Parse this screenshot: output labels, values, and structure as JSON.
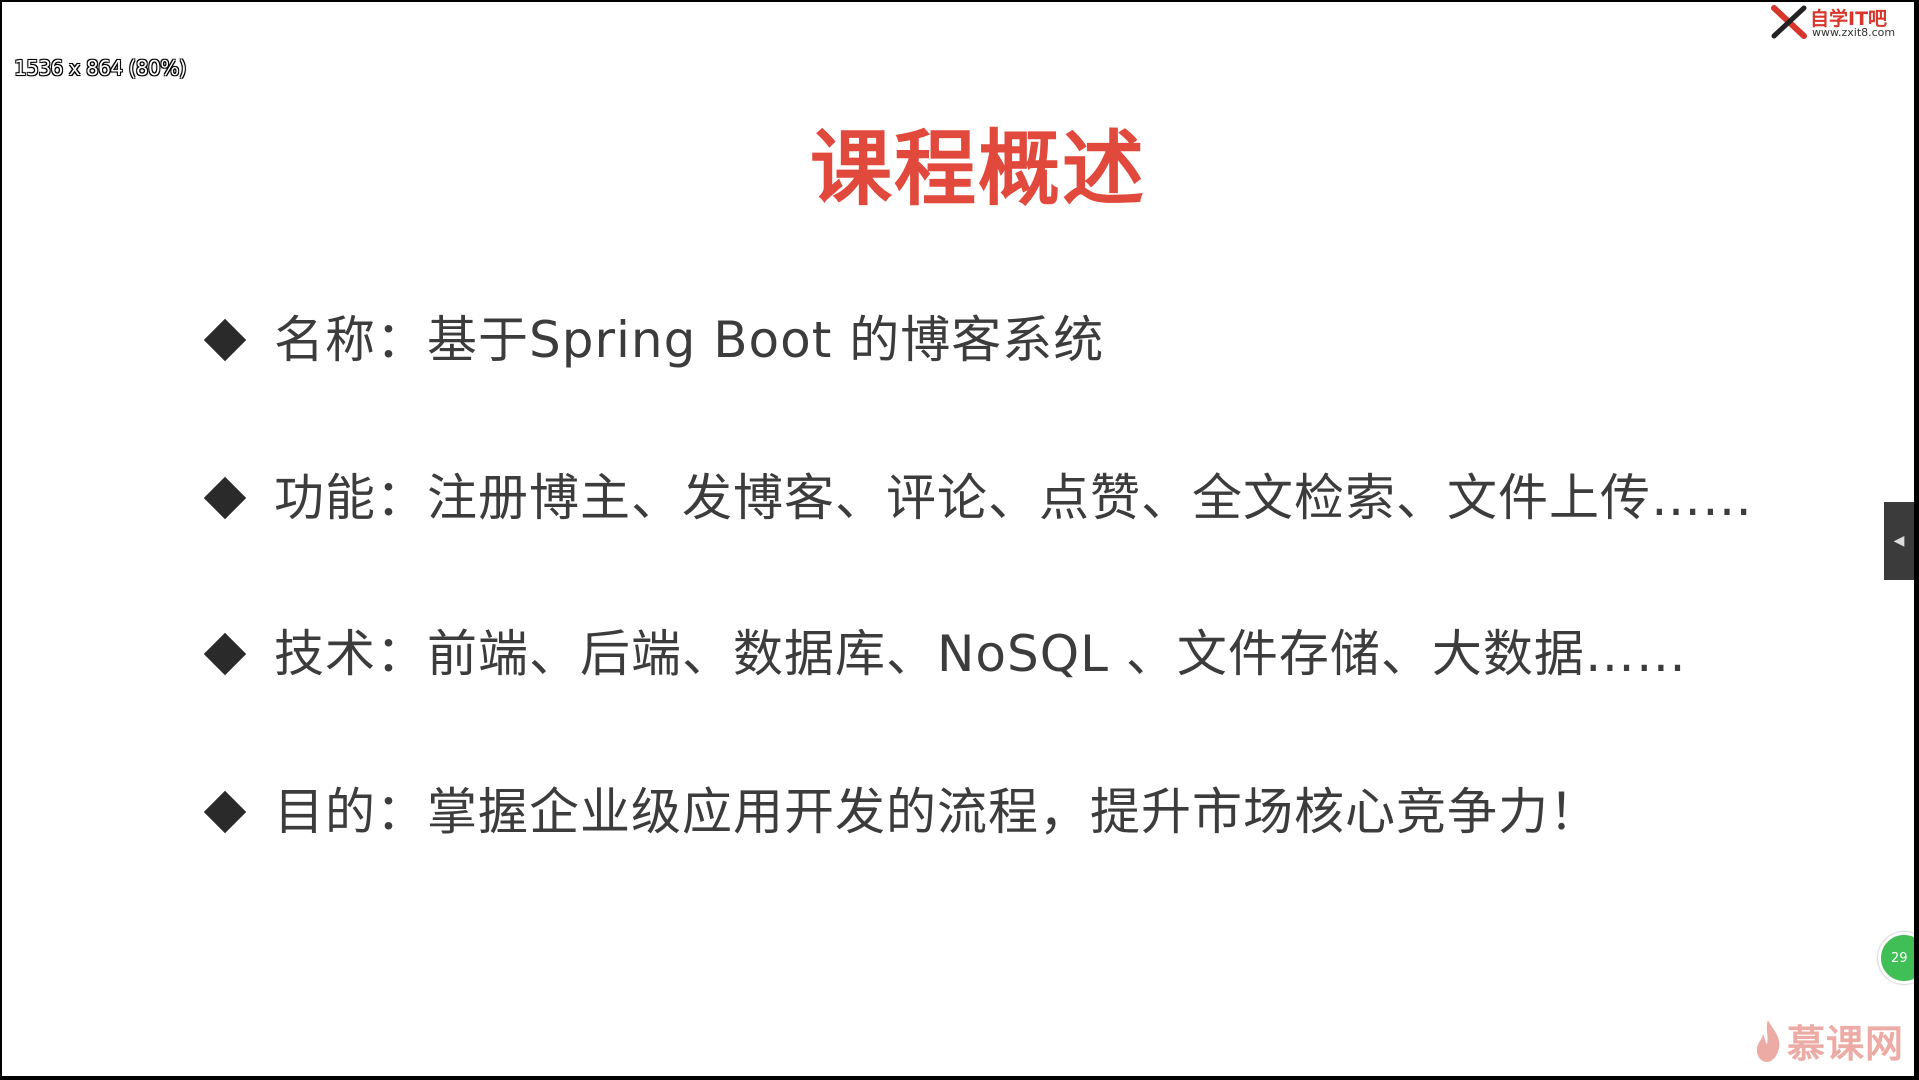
{
  "viewer": {
    "zoom_indicator": "1536 x 864 (80%)"
  },
  "slide": {
    "title": "课程概述",
    "bullets": [
      "名称：基于Spring Boot 的博客系统",
      "功能：注册博主、发博客、评论、点赞、全文检索、文件上传……",
      "技术：前端、后端、数据库、NoSQL 、文件存储、大数据……",
      "目的：掌握企业级应用开发的流程，提升市场核心竞争力！"
    ]
  },
  "logo": {
    "name": "自学IT吧",
    "url": "www.zxit8.com"
  },
  "badge": {
    "text": "29"
  },
  "watermark": {
    "text": "慕课网"
  },
  "colors": {
    "title": "#e2493d",
    "text": "#3c3c3c",
    "bullet": "#2a2a2a",
    "badge": "#3fbf55"
  },
  "icons": {
    "side_toggle": "chevron-left-icon",
    "watermark": "flame-icon",
    "logo": "x-logo-icon"
  }
}
